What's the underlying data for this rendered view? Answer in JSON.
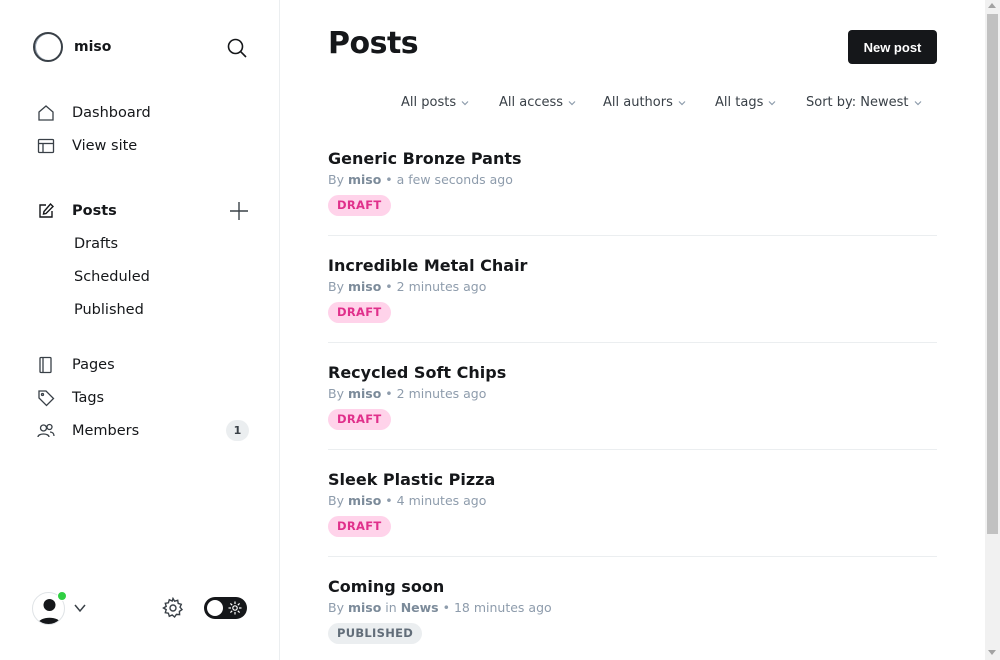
{
  "brand": {
    "name": "miso"
  },
  "nav": {
    "dashboard": "Dashboard",
    "view_site": "View site",
    "posts": "Posts",
    "drafts": "Drafts",
    "scheduled": "Scheduled",
    "published": "Published",
    "pages": "Pages",
    "tags": "Tags",
    "members": "Members",
    "members_count": "1"
  },
  "main": {
    "title": "Posts",
    "new_post_label": "New post",
    "filters": [
      "All posts",
      "All access",
      "All authors",
      "All tags",
      "Sort by: Newest"
    ]
  },
  "posts": [
    {
      "title": "Generic Bronze Pants",
      "by": "By",
      "author": "miso",
      "in": "",
      "tag": "",
      "time": "a few seconds ago",
      "status": "DRAFT"
    },
    {
      "title": "Incredible Metal Chair",
      "by": "By",
      "author": "miso",
      "in": "",
      "tag": "",
      "time": "2 minutes ago",
      "status": "DRAFT"
    },
    {
      "title": "Recycled Soft Chips",
      "by": "By",
      "author": "miso",
      "in": "",
      "tag": "",
      "time": "2 minutes ago",
      "status": "DRAFT"
    },
    {
      "title": "Sleek Plastic Pizza",
      "by": "By",
      "author": "miso",
      "in": "",
      "tag": "",
      "time": "4 minutes ago",
      "status": "DRAFT"
    },
    {
      "title": "Coming soon",
      "by": "By",
      "author": "miso",
      "in": "in",
      "tag": "News",
      "time": "18 minutes ago",
      "status": "PUBLISHED"
    }
  ],
  "colors": {
    "accent": "#15171a",
    "draft_bg": "#ffd3ea",
    "draft_text": "#e02f8b",
    "published_bg": "#ebeef0",
    "online": "#30cf43"
  },
  "icons": {
    "brand": "circle-logo-icon",
    "search": "search-icon",
    "dashboard": "home-icon",
    "view_site": "layout-icon",
    "posts": "edit-icon",
    "add": "plus-icon",
    "pages": "page-icon",
    "tags": "tag-icon",
    "members": "members-icon",
    "settings": "gear-icon",
    "theme": "sun-icon"
  }
}
